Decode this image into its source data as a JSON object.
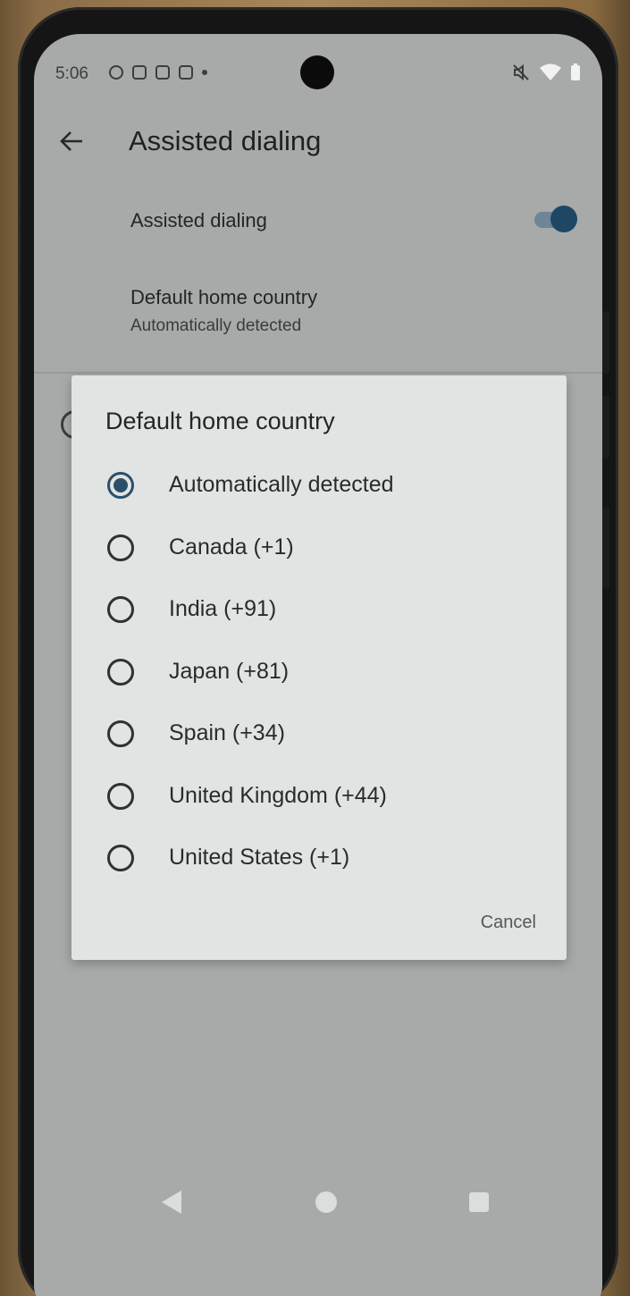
{
  "status_bar": {
    "time": "5:06",
    "left_icons": [
      "notification-icon",
      "sim-icon",
      "clipboard-icon",
      "message-icon",
      "dot-icon"
    ],
    "right_icons": [
      "mute-icon",
      "wifi-icon",
      "battery-icon"
    ]
  },
  "header": {
    "title": "Assisted dialing",
    "back_icon": "back-arrow-icon"
  },
  "settings": {
    "assisted_dialing": {
      "title": "Assisted dialing",
      "enabled": true
    },
    "default_home_country": {
      "title": "Default home country",
      "summary": "Automatically detected"
    }
  },
  "dialog": {
    "title": "Default home country",
    "options": [
      {
        "label": "Automatically detected",
        "selected": true
      },
      {
        "label": "Canada (+1)",
        "selected": false
      },
      {
        "label": "India (+91)",
        "selected": false
      },
      {
        "label": "Japan (+81)",
        "selected": false
      },
      {
        "label": "Spain (+34)",
        "selected": false
      },
      {
        "label": "United Kingdom (+44)",
        "selected": false
      },
      {
        "label": "United States (+1)",
        "selected": false
      }
    ],
    "cancel_label": "Cancel"
  },
  "colors": {
    "accent": "#2b4f6b",
    "toggle_track": "#6d8596",
    "dialog_bg": "#e2e3e3",
    "screen_bg": "#a8a9a9"
  },
  "nav_bar": {
    "buttons": [
      "nav-back-icon",
      "nav-home-icon",
      "nav-recents-icon"
    ]
  }
}
